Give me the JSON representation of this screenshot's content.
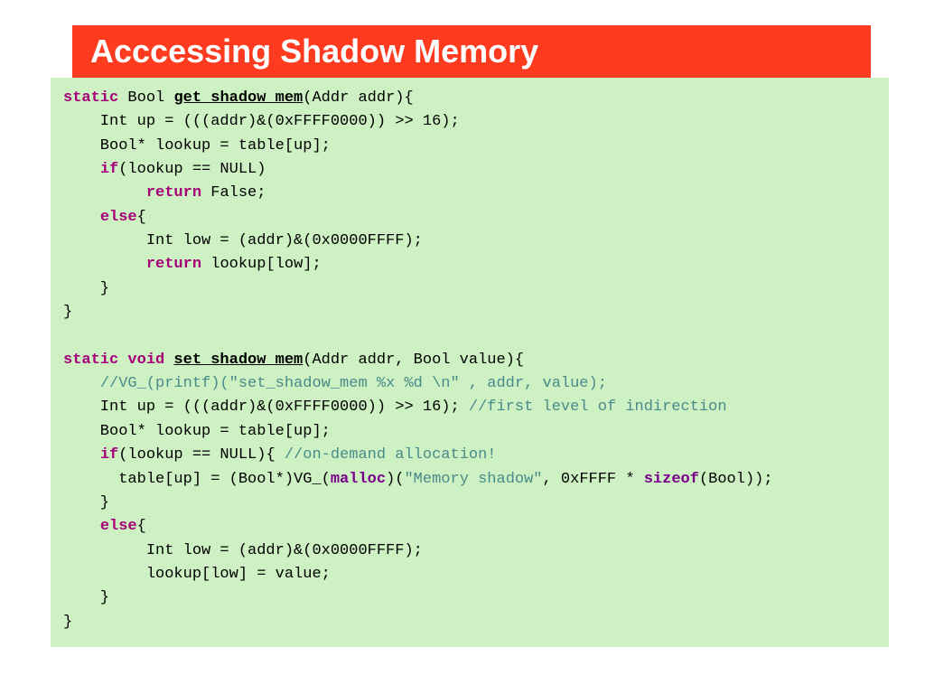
{
  "title": "Acccessing Shadow Memory",
  "code": {
    "l01a": "static",
    "l01b": " Bool ",
    "l01c": "get_shadow_mem",
    "l01d": "(Addr addr){",
    "l02": "    Int up = (((addr)&(0xFFFF0000)) >> 16);",
    "l03": "    Bool* lookup = table[up];",
    "l04a": "    ",
    "l04b": "if",
    "l04c": "(lookup == NULL)",
    "l05a": "         ",
    "l05b": "return",
    "l05c": " False;",
    "l06a": "    ",
    "l06b": "else",
    "l06c": "{",
    "l07": "         Int low = (addr)&(0x0000FFFF);",
    "l08a": "         ",
    "l08b": "return",
    "l08c": " lookup[low];",
    "l09": "    }",
    "l10": "}",
    "blank": "",
    "l11a": "static void",
    "l11b": " ",
    "l11c": "set_shadow_mem",
    "l11d": "(Addr addr, Bool value){",
    "l12a": "    ",
    "l12b": "//VG_(printf)(\"set_shadow_mem %x %d \\n\" , addr, value);",
    "l13a": "    Int up = (((addr)&(0xFFFF0000)) >> 16); ",
    "l13b": "//first level of indirection",
    "l14": "    Bool* lookup = table[up];",
    "l15a": "    ",
    "l15b": "if",
    "l15c": "(lookup == NULL){ ",
    "l15d": "//on-demand allocation!",
    "l16a": "      table[up] = (Bool*)VG_(",
    "l16b": "malloc",
    "l16c": ")(",
    "l16d": "\"Memory shadow\"",
    "l16e": ", 0xFFFF * ",
    "l16f": "sizeof",
    "l16g": "(Bool));",
    "l17": "    }",
    "l18a": "    ",
    "l18b": "else",
    "l18c": "{",
    "l19": "         Int low = (addr)&(0x0000FFFF);",
    "l20": "         lookup[low] = value;",
    "l21": "    }",
    "l22": "}"
  }
}
